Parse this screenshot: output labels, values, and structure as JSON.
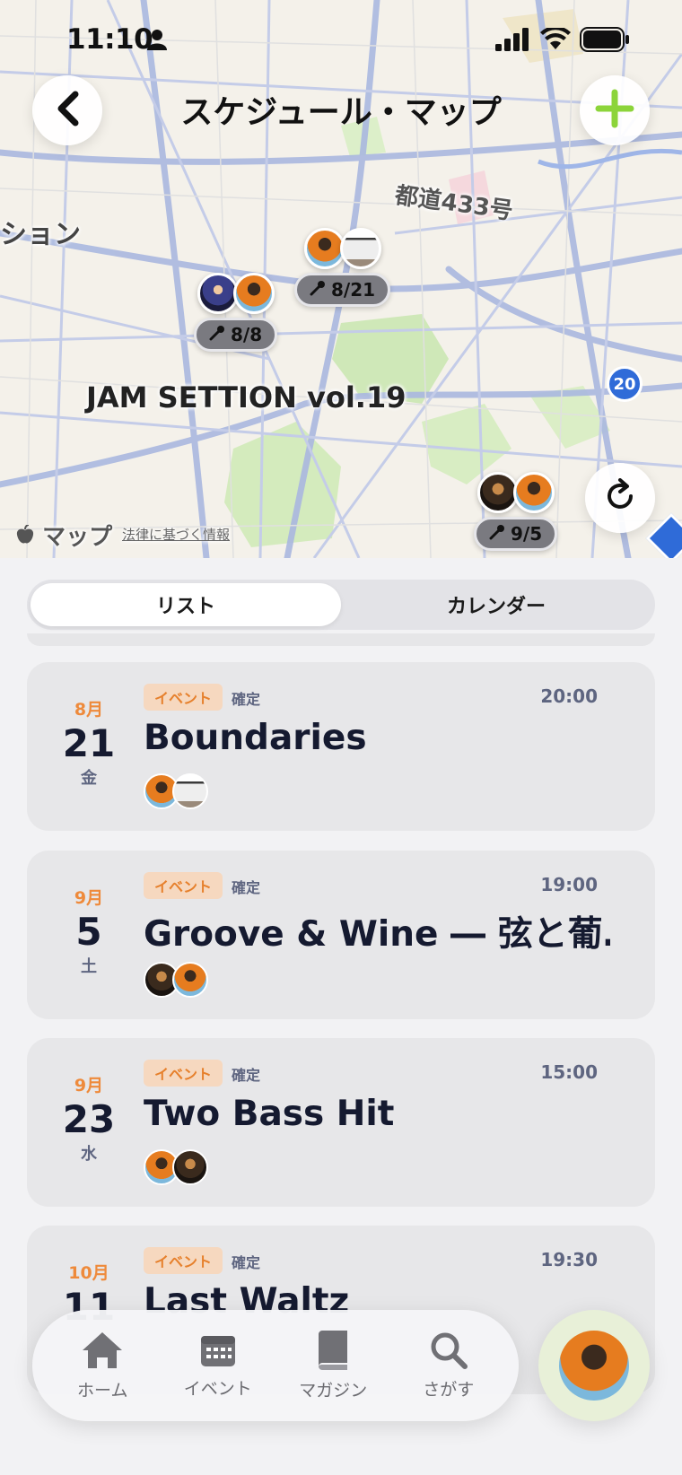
{
  "status_bar": {
    "time": "11:10"
  },
  "header": {
    "title": "スケジュール・マップ"
  },
  "map": {
    "road_label": "都道433号",
    "station_label": "ション",
    "venue_label": "JAM SETTION vol.19",
    "maps_brand": "マップ",
    "legal_link": "法律に基づく情報",
    "route_number": "20",
    "pins": [
      {
        "date": "8/21"
      },
      {
        "date": "8/8"
      },
      {
        "date": "9/5"
      }
    ]
  },
  "segmented": {
    "list": "リスト",
    "calendar": "カレンダー"
  },
  "events": [
    {
      "month": "8月",
      "day": "21",
      "weekday": "金",
      "tag": "イベント",
      "status": "確定",
      "time": "20:00",
      "title": "Boundaries"
    },
    {
      "month": "9月",
      "day": "5",
      "weekday": "土",
      "tag": "イベント",
      "status": "確定",
      "time": "19:00",
      "title": "Groove & Wine ― 弦と葡…"
    },
    {
      "month": "9月",
      "day": "23",
      "weekday": "水",
      "tag": "イベント",
      "status": "確定",
      "time": "15:00",
      "title": "Two Bass Hit"
    },
    {
      "month": "10月",
      "day": "11",
      "weekday": "",
      "tag": "イベント",
      "status": "確定",
      "time": "19:30",
      "title": "Last Waltz"
    }
  ],
  "tabbar": {
    "home": "ホーム",
    "event": "イベント",
    "magazine": "マガジン",
    "search": "さがす"
  },
  "colors": {
    "accent_orange": "#ee8a3b",
    "add_green": "#8cd43a",
    "map_route": "#2f6bd8"
  }
}
